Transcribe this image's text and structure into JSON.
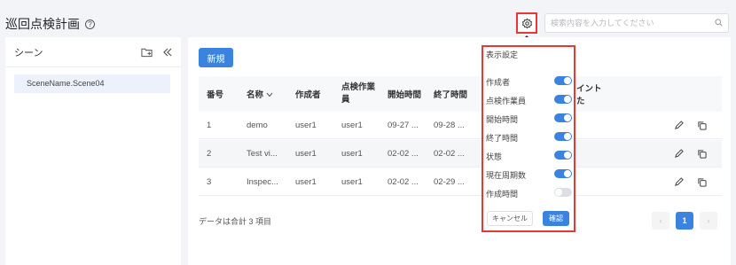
{
  "header": {
    "title": "巡回点検計画",
    "help_icon": "?",
    "settings_tooltip": "設定",
    "search_placeholder": "検索内容を入力してください"
  },
  "sidebar": {
    "title": "シーン",
    "items": [
      {
        "label": "SceneName.Scene04"
      }
    ]
  },
  "main": {
    "new_button": "新規",
    "columns": {
      "number": "番号",
      "name": "名称",
      "creator": "作成者",
      "inspector": "点検作業員",
      "start_time": "開始時間",
      "end_time": "終了時間",
      "hidden_partial_1": "イント",
      "hidden_partial_2": "た"
    },
    "rows": [
      {
        "number": "1",
        "name": "demo",
        "creator": "user1",
        "inspector": "user1",
        "start_time": "09-27 ...",
        "end_time": "09-28 ..."
      },
      {
        "number": "2",
        "name": "Test vi...",
        "creator": "user1",
        "inspector": "user1",
        "start_time": "02-02 ...",
        "end_time": "02-02 ..."
      },
      {
        "number": "3",
        "name": "Inspec...",
        "creator": "user1",
        "inspector": "user1",
        "start_time": "02-02 ...",
        "end_time": "02-29 ..."
      }
    ],
    "footer_text": "データは合計 3 項目",
    "pagination": {
      "prev": "‹",
      "page": "1",
      "next": "›"
    }
  },
  "settings_popup": {
    "title": "表示設定",
    "items": [
      {
        "label": "作成者",
        "enabled": true
      },
      {
        "label": "点検作業員",
        "enabled": true
      },
      {
        "label": "開始時間",
        "enabled": true
      },
      {
        "label": "終了時間",
        "enabled": true
      },
      {
        "label": "状態",
        "enabled": true
      },
      {
        "label": "現在周期数",
        "enabled": true
      },
      {
        "label": "作成時間",
        "enabled": false
      }
    ],
    "cancel": "キャンセル",
    "confirm": "確認"
  },
  "colors": {
    "accent": "#3a84e0",
    "highlight_border": "#e53935"
  }
}
